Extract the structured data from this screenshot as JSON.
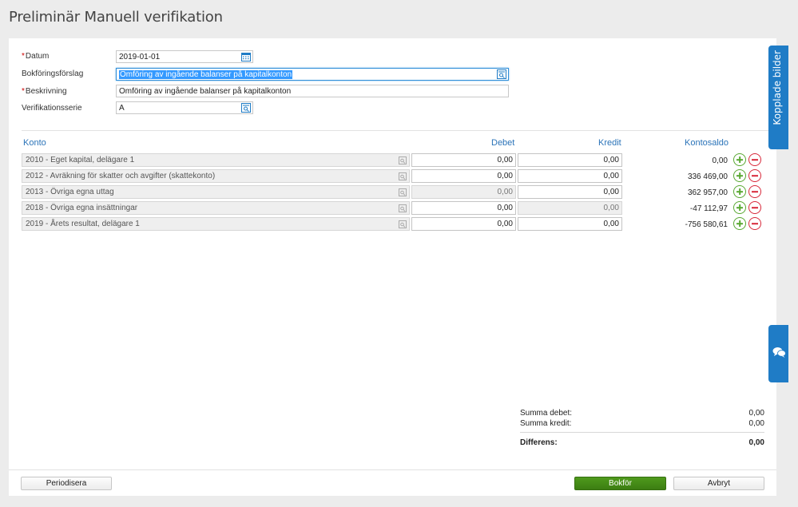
{
  "page": {
    "title": "Preliminär Manuell verifikation"
  },
  "form": {
    "datum": {
      "label": "Datum",
      "required": true,
      "value": "2019-01-01"
    },
    "bokforingsforslag": {
      "label": "Bokföringsförslag",
      "required": false,
      "value": "Omföring av ingående balanser på kapitalkonton"
    },
    "beskrivning": {
      "label": "Beskrivning",
      "required": true,
      "value": "Omföring av ingående balanser på kapitalkonton"
    },
    "verifikationsserie": {
      "label": "Verifikationsserie",
      "required": false,
      "value": "A"
    }
  },
  "table": {
    "headers": {
      "konto": "Konto",
      "debet": "Debet",
      "kredit": "Kredit",
      "kontosaldo": "Kontosaldo"
    },
    "rows": [
      {
        "konto": "2010 - Eget kapital, delägare 1",
        "debet": "0,00",
        "kredit": "0,00",
        "saldo": "0,00",
        "debet_disabled": false,
        "kredit_disabled": false
      },
      {
        "konto": "2012 - Avräkning för skatter och avgifter (skattekonto)",
        "debet": "0,00",
        "kredit": "0,00",
        "saldo": "336 469,00",
        "debet_disabled": false,
        "kredit_disabled": false
      },
      {
        "konto": "2013 - Övriga egna uttag",
        "debet": "0,00",
        "kredit": "0,00",
        "saldo": "362 957,00",
        "debet_disabled": true,
        "kredit_disabled": false
      },
      {
        "konto": "2018 - Övriga egna insättningar",
        "debet": "0,00",
        "kredit": "0,00",
        "saldo": "-47 112,97",
        "debet_disabled": false,
        "kredit_disabled": true
      },
      {
        "konto": "2019 - Årets resultat, delägare 1",
        "debet": "0,00",
        "kredit": "0,00",
        "saldo": "-756 580,61",
        "debet_disabled": false,
        "kredit_disabled": false
      }
    ]
  },
  "summary": {
    "summa_debet_label": "Summa debet:",
    "summa_debet": "0,00",
    "summa_kredit_label": "Summa kredit:",
    "summa_kredit": "0,00",
    "differens_label": "Differens:",
    "differens": "0,00"
  },
  "buttons": {
    "periodisera": "Periodisera",
    "bokfor": "Bokför",
    "avbryt": "Avbryt"
  },
  "side_tabs": {
    "kopplade_bilder": "Kopplade bilder"
  },
  "icons": {
    "calendar": "calendar-icon",
    "lookup": "lookup-icon",
    "add": "plus-circle-icon",
    "remove": "minus-circle-icon",
    "chat": "chat-icon"
  },
  "colors": {
    "accent": "#1f7cc6",
    "primary_button": "#3f8a15",
    "link": "#2a73b8",
    "add": "#59a832",
    "remove": "#d8283a"
  }
}
